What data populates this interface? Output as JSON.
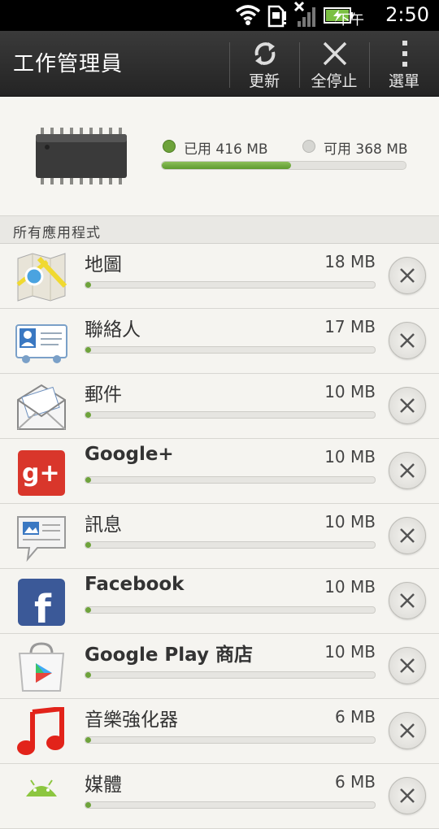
{
  "status_bar": {
    "ampm": "下午",
    "time": "2:50"
  },
  "action_bar": {
    "title": "工作管理員",
    "buttons": {
      "refresh": "更新",
      "stop_all": "全停止",
      "menu": "選單"
    }
  },
  "memory": {
    "used_label": "已用 416 MB",
    "free_label": "可用 368 MB",
    "used_fraction": 0.53,
    "colors": {
      "used": "#6ea33b",
      "free": "#cfcfcf"
    }
  },
  "section_title": "所有應用程式",
  "apps": [
    {
      "name": "地圖",
      "size": "18 MB",
      "fraction": 0.02,
      "icon": "maps-icon",
      "bold": false
    },
    {
      "name": "聯絡人",
      "size": "17 MB",
      "fraction": 0.02,
      "icon": "contacts-icon",
      "bold": false
    },
    {
      "name": "郵件",
      "size": "10 MB",
      "fraction": 0.015,
      "icon": "mail-icon",
      "bold": false
    },
    {
      "name": "Google+",
      "size": "10 MB",
      "fraction": 0.015,
      "icon": "google-plus-icon",
      "bold": true
    },
    {
      "name": "訊息",
      "size": "10 MB",
      "fraction": 0.015,
      "icon": "messages-icon",
      "bold": false
    },
    {
      "name": "Facebook",
      "size": "10 MB",
      "fraction": 0.015,
      "icon": "facebook-icon",
      "bold": true
    },
    {
      "name": "Google Play 商店",
      "size": "10 MB",
      "fraction": 0.015,
      "icon": "google-play-store-icon",
      "bold": true
    },
    {
      "name": "音樂強化器",
      "size": "6 MB",
      "fraction": 0.01,
      "icon": "music-enhancer-icon",
      "bold": false
    },
    {
      "name": "媒體",
      "size": "6 MB",
      "fraction": 0.01,
      "icon": "android-media-icon",
      "bold": false
    }
  ]
}
